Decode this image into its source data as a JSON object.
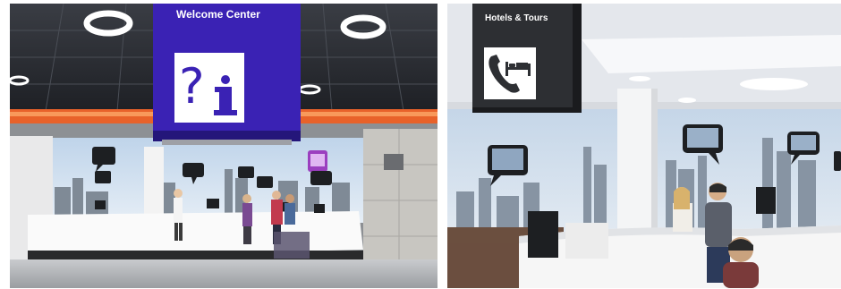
{
  "left_photo": {
    "sign_title": "Welcome Center",
    "sign_icon": "question-info-icon",
    "colors": {
      "sign": "#3a22b4",
      "accent_strip": "#e8622a"
    }
  },
  "right_photo": {
    "sign_title": "Hotels & Tours",
    "sign_icon": "phone-bed-icon",
    "colors": {
      "sign": "#2d2f33",
      "wall": "#f2f3f5"
    }
  }
}
